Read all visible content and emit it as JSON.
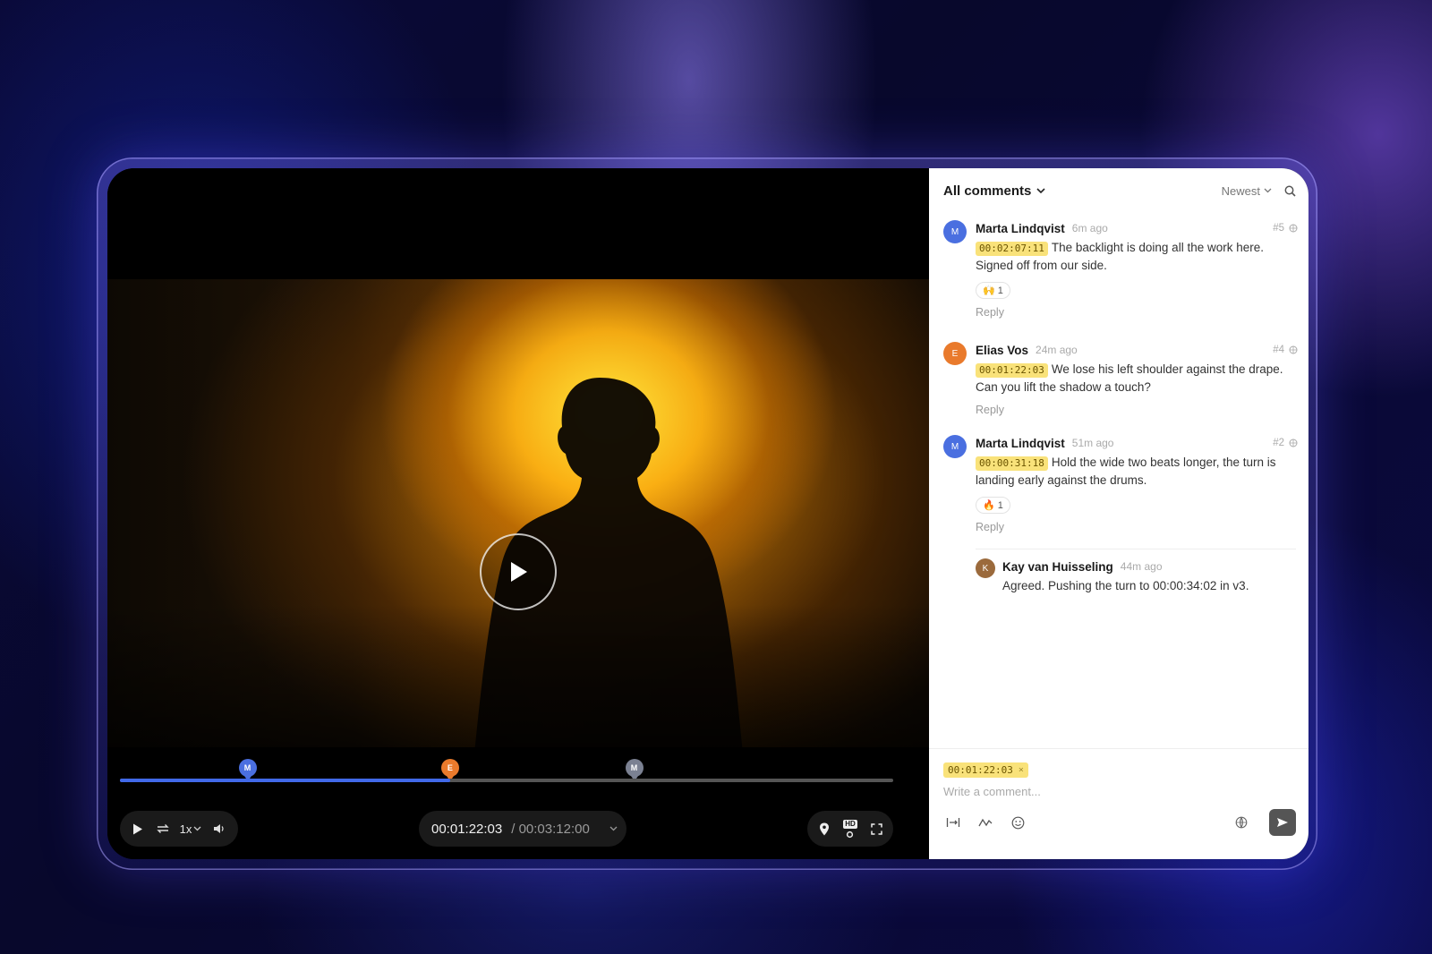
{
  "player": {
    "current_time": "00:01:22:03",
    "total_time": "/ 00:03:12:00",
    "speed_label": "1x",
    "progress": 0.427,
    "hd_label": "HD",
    "markers": [
      {
        "initial": "M",
        "position": 0.165,
        "color": "#4a6fe0"
      },
      {
        "initial": "E",
        "position": 0.427,
        "color": "#e97a2c"
      },
      {
        "initial": "M",
        "position": 0.665,
        "color": "#7b8192"
      }
    ]
  },
  "panel": {
    "filter_label": "All comments",
    "sort_label": "Newest",
    "comments": [
      {
        "author": "Marta Lindqvist",
        "initial": "M",
        "avatar_color": "#4a6fe0",
        "time": "6m ago",
        "number": "#5",
        "timestamp": "00:02:07:11",
        "text": "The backlight is doing all the work here. Signed off from our side.",
        "reaction_emoji": "🙌",
        "reaction_count": "1",
        "reply_label": "Reply"
      },
      {
        "author": "Elias Vos",
        "initial": "E",
        "avatar_color": "#e97a2c",
        "time": "24m ago",
        "number": "#4",
        "timestamp": "00:01:22:03",
        "text": "We lose his left shoulder against the drape. Can you lift the shadow a touch?",
        "reply_label": "Reply"
      },
      {
        "author": "Marta Lindqvist",
        "initial": "M",
        "avatar_color": "#4a6fe0",
        "time": "51m ago",
        "number": "#2",
        "timestamp": "00:00:31:18",
        "text": "Hold the wide two beats longer, the turn is landing early against the drums.",
        "reaction_emoji": "🔥",
        "reaction_count": "1",
        "reply_label": "Reply"
      }
    ],
    "reply": {
      "author": "Kay van Huisseling",
      "initial": "K",
      "avatar_color": "#9b6a3c",
      "time": "44m ago",
      "text": "Agreed. Pushing the turn to 00:00:34:02 in v3."
    },
    "composer": {
      "timestamp": "00:01:22:03",
      "remove_label": "×",
      "placeholder": "Write a comment..."
    }
  }
}
